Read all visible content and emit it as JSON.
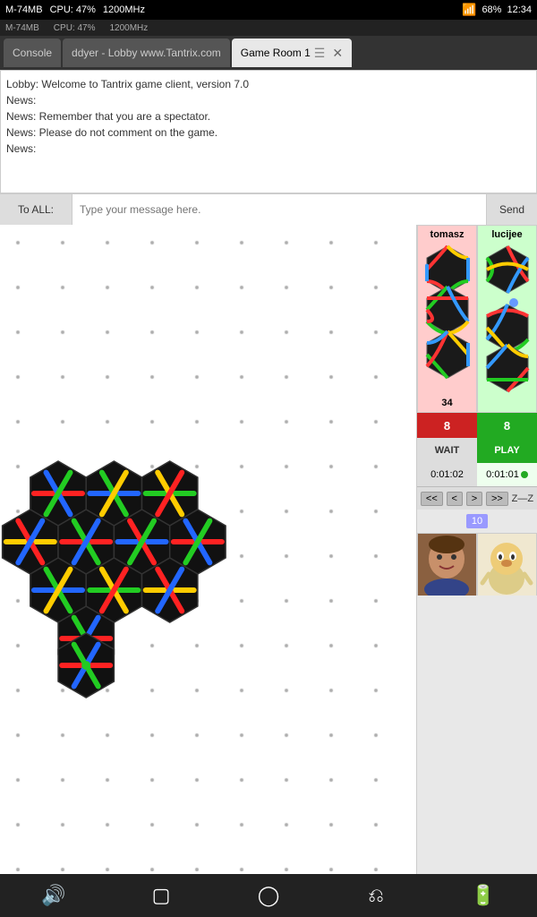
{
  "statusBar": {
    "memory": "M-74MB",
    "cpu": "CPU: 47%",
    "freq": "1200MHz",
    "battery": "68%",
    "time": "12:34"
  },
  "tabs": [
    {
      "id": "console",
      "label": "Console",
      "active": false
    },
    {
      "id": "lobby",
      "label": "ddyer - Lobby www.Tantrix.com",
      "active": false
    },
    {
      "id": "gameroom",
      "label": "Game Room 1",
      "active": true
    }
  ],
  "chat": {
    "messages": [
      "Lobby: Welcome to Tantrix game client, version 7.0",
      "News:",
      "News: Remember that you are a spectator.",
      "News: Please do not comment on the game.",
      "News:"
    ]
  },
  "messageBar": {
    "toLabel": "To ALL:",
    "placeholder": "Type your message here.",
    "sendLabel": "Send"
  },
  "players": [
    {
      "name": "tomasz",
      "score": "34",
      "scoreNum": 8,
      "status": "WAIT",
      "timer": "0:01:02",
      "timerActive": false,
      "panelColor": "tomasz"
    },
    {
      "name": "lucijee",
      "score": "",
      "scoreNum": 8,
      "status": "PLAY",
      "timer": "0:01:01",
      "timerActive": true,
      "panelColor": "lucijee"
    }
  ],
  "controls": {
    "buttons": [
      "<<",
      "<",
      ">",
      ">>"
    ],
    "undoLabel": "Z—Z",
    "moveCount": "10"
  },
  "board": {
    "dotColor": "#aaa",
    "dotSpacing": 50
  }
}
